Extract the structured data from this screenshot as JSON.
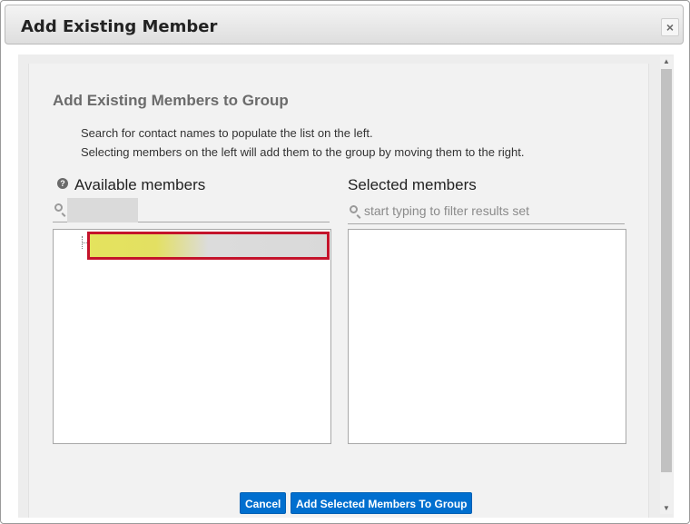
{
  "dialog": {
    "title": "Add Existing Member",
    "close_label": "×"
  },
  "content": {
    "heading": "Add Existing Members to Group",
    "description_line1": "Search for contact names to populate the list on the left.",
    "description_line2": "Selecting members on the left will add them to the group by moving them to the right."
  },
  "available": {
    "title": "Available members",
    "help_icon": "question-circle-icon",
    "help_glyph": "?",
    "search_value": ""
  },
  "selected": {
    "title": "Selected members",
    "search_placeholder": "start typing to filter results set"
  },
  "buttons": {
    "cancel_label": "Cancel",
    "add_label": "Add Selected Members To Group"
  },
  "colors": {
    "primary_button": "#006fcf",
    "selection_border": "#c4132b"
  },
  "scrollbar": {
    "up_glyph": "▲",
    "down_glyph": "▼"
  }
}
